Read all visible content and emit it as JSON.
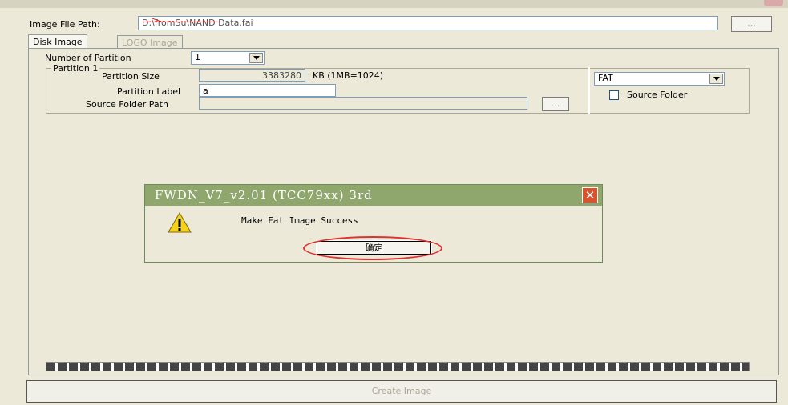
{
  "path": {
    "label": "Image File Path:",
    "value": "D:\\fromSu\\NAND Data.fai",
    "browse_label": "..."
  },
  "tabs": [
    {
      "label": "Disk Image",
      "active": true
    },
    {
      "label": "LOGO Image",
      "active": false
    }
  ],
  "partition_count": {
    "label": "Number of Partition",
    "value": "1"
  },
  "partition": {
    "group_label": "Partition 1",
    "size_label": "Partition Size",
    "size_value": "3383280",
    "size_unit": "KB (1MB=1024)",
    "name_label": "Partition Label",
    "name_value": "a",
    "folder_label": "Source Folder Path",
    "folder_value": "",
    "folder_browse_label": "...",
    "fs_value": "FAT",
    "source_folder_checkbox": "Source Folder"
  },
  "progress": {
    "fraction": 1.0
  },
  "create_button": "Create Image",
  "dialog": {
    "title": "FWDN_V7_v2.01 (TCC79xx) 3rd",
    "message": "Make Fat Image Success",
    "ok_label": "确定",
    "icon": "warning-icon"
  },
  "colors": {
    "window_bg": "#ece9d8",
    "dialog_title_bg": "#8fa76d",
    "close_bg": "#d9532e",
    "annotation_red": "#e03030"
  }
}
